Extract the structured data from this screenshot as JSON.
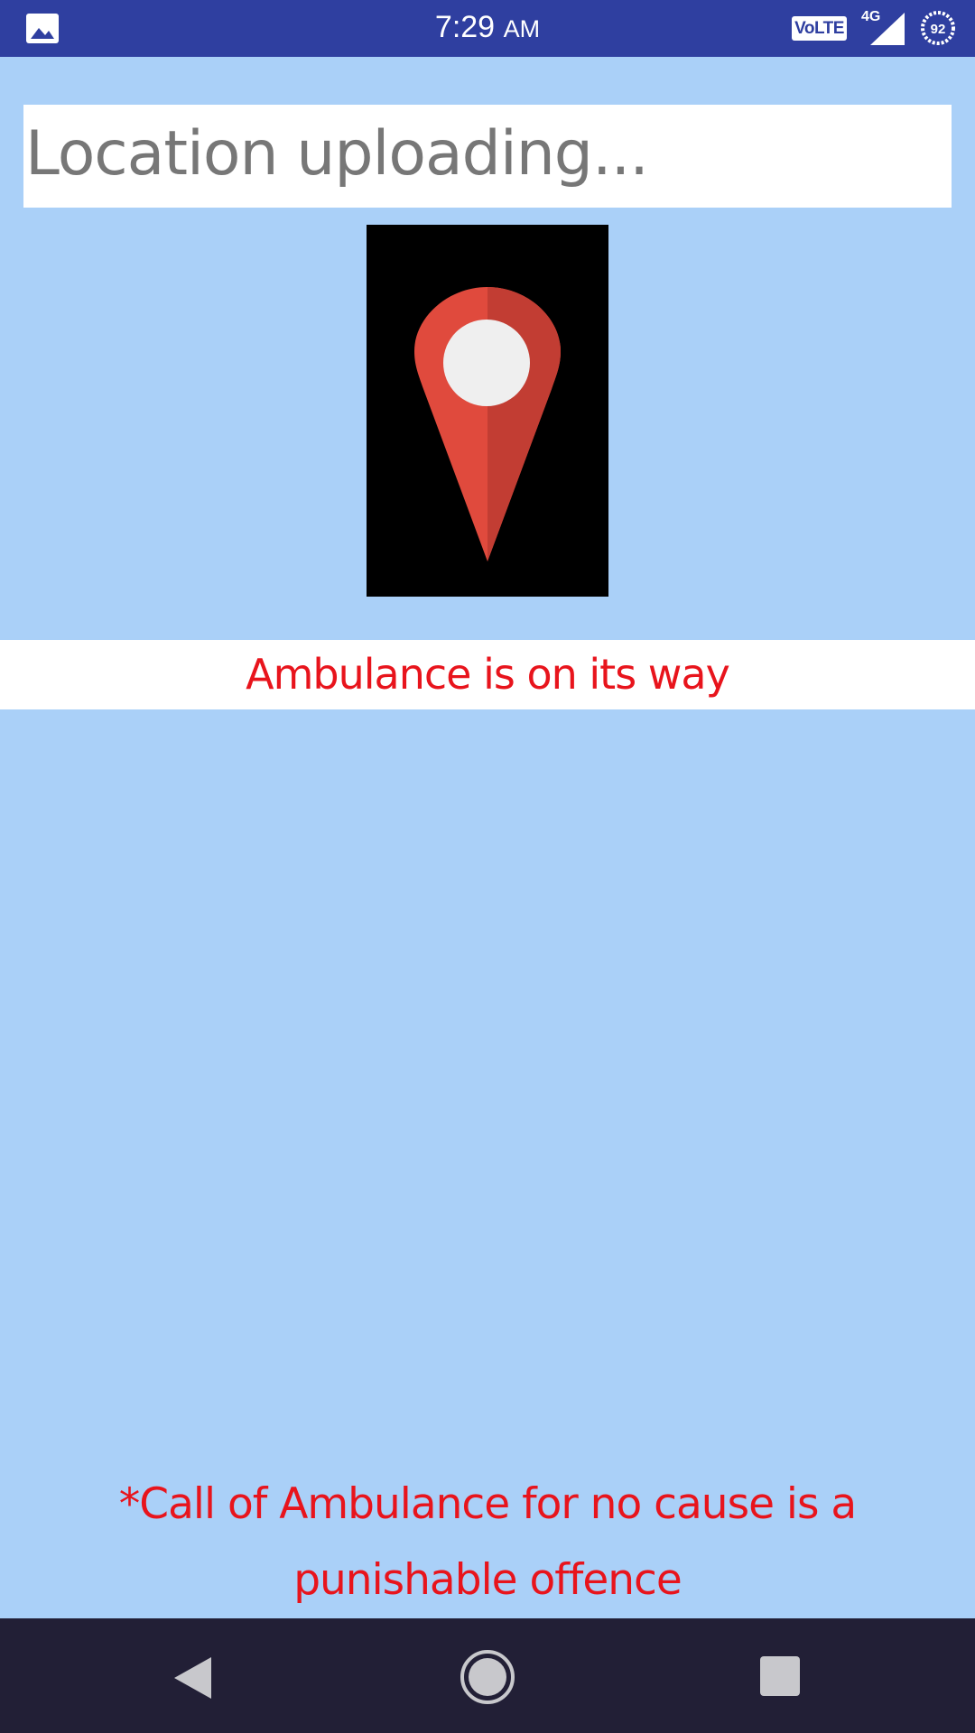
{
  "status_bar": {
    "time": "7:29",
    "ampm": "AM",
    "volte": "VoLTE",
    "network": "4G",
    "battery": "92",
    "icons": [
      "gallery-icon",
      "signal-icon",
      "battery-icon"
    ]
  },
  "main": {
    "location_status": "Location uploading...",
    "image_icon": "map-pin-icon",
    "ambulance_status": "Ambulance is on its way",
    "warning": "*Call of Ambulance for no cause is a punishable offence"
  },
  "nav_bar": {
    "icons": [
      "back-icon",
      "home-icon",
      "recents-icon"
    ]
  },
  "colors": {
    "background": "#aad0f8",
    "status_bar": "#2f3fa0",
    "nav_bar": "#221f36",
    "alert_text": "#e8141c",
    "placeholder_text": "#777777",
    "pin_red": "#e04a3d"
  }
}
